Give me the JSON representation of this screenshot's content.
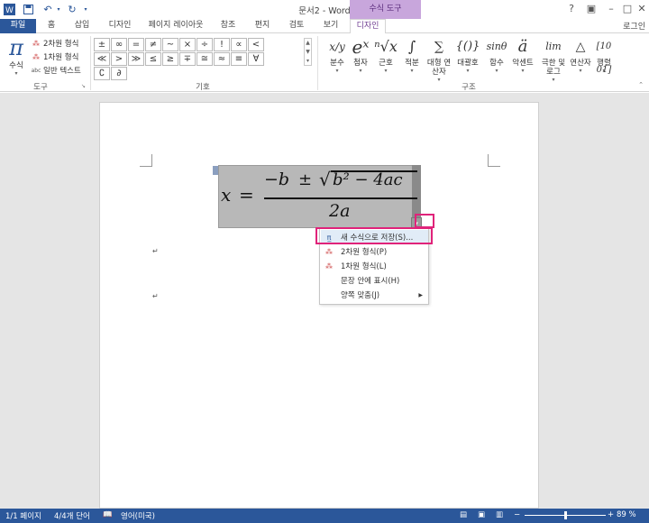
{
  "window": {
    "title": "문서2 - Word",
    "context_tab": "수식 도구",
    "login": "로그인"
  },
  "tabs": [
    {
      "label": "파일"
    },
    {
      "label": "홈"
    },
    {
      "label": "삽입"
    },
    {
      "label": "디자인"
    },
    {
      "label": "페이지 레이아웃"
    },
    {
      "label": "참조"
    },
    {
      "label": "편지"
    },
    {
      "label": "검토"
    },
    {
      "label": "보기"
    },
    {
      "label": "디자인"
    }
  ],
  "ribbon": {
    "tools": {
      "equation_label": "수식",
      "professional": "2차원 형식",
      "linear": "1차원 형식",
      "normal_text": "일반 텍스트",
      "group_label": "도구"
    },
    "symbols": {
      "items": [
        "±",
        "∞",
        "=",
        "≠",
        "~",
        "×",
        "÷",
        "!",
        "∝",
        "<",
        "≪",
        "&gt;",
        "≫",
        "≤",
        "≥",
        "∓",
        "≅",
        "≈",
        "≡",
        "∀",
        "∁",
        "∂"
      ],
      "group_label": "기호"
    },
    "structures": {
      "items": [
        {
          "icon": "x/y",
          "label": "분수"
        },
        {
          "icon": "eˣ",
          "label": "첨자"
        },
        {
          "icon": "ⁿ√x",
          "label": "근호"
        },
        {
          "icon": "∫",
          "label": "적분"
        },
        {
          "icon": "∑",
          "label": "대형 연산자"
        },
        {
          "icon": "{()}",
          "label": "대괄호"
        },
        {
          "icon": "sinθ",
          "label": "함수"
        },
        {
          "icon": "ä",
          "label": "악센트"
        },
        {
          "icon": "lim",
          "label": "극한 및 로그"
        },
        {
          "icon": "△",
          "label": "연산자"
        },
        {
          "icon": "[10 01]",
          "label": "행렬"
        }
      ],
      "group_label": "구조"
    }
  },
  "equation": {
    "lhs": "x",
    "equals": "=",
    "numerator_neg_b": "−b",
    "pm": "±",
    "radicand": "b² − 4ac",
    "denominator": "2a"
  },
  "menu": {
    "items": [
      {
        "label": "새 수식으로 저장(S)...",
        "icon": "save-equation-icon"
      },
      {
        "label": "2차원 형식(P)",
        "icon": "professional-format-icon"
      },
      {
        "label": "1차원 형식(L)",
        "icon": "linear-format-icon"
      },
      {
        "label": "문장 안에 표시(H)",
        "icon": ""
      },
      {
        "label": "양쪽 맞춤(J)",
        "icon": ""
      }
    ]
  },
  "status": {
    "page": "1/1 페이지",
    "words": "4/4개 단어",
    "language": "영어(미국)",
    "zoom": "89 %"
  },
  "colors": {
    "brand": "#2b579a",
    "context": "#c8a6dc",
    "highlight": "#e0237a"
  }
}
